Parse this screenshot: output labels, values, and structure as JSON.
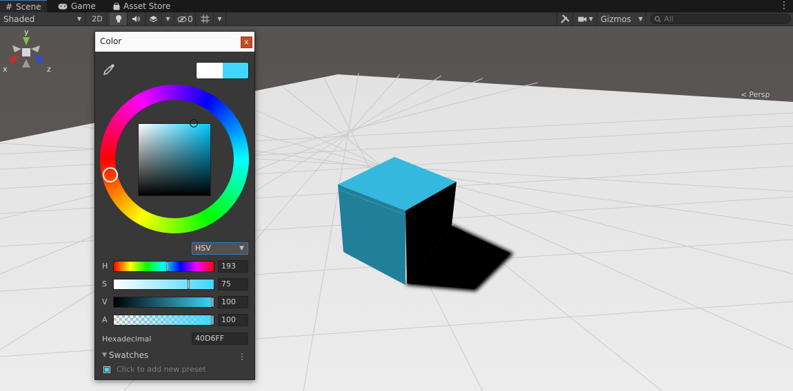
{
  "tabs": [
    {
      "label": "Scene",
      "icon": "grid-icon",
      "active": true
    },
    {
      "label": "Game",
      "icon": "gamepad-icon",
      "active": false
    },
    {
      "label": "Asset Store",
      "icon": "bag-icon",
      "active": false
    }
  ],
  "toolbar": {
    "shading_mode": "Shaded",
    "mode_2d": "2D",
    "hidden_count": "0",
    "gizmos_label": "Gizmos",
    "search_placeholder": "All"
  },
  "scene": {
    "orientation": {
      "x": "x",
      "y": "y",
      "z": "z"
    },
    "projection": "Persp",
    "cube_color": "#3ab3d8"
  },
  "color_window": {
    "title": "Color",
    "close_label": "x",
    "previous_color": "#ffffff",
    "current_color": "#40d6ff",
    "mode": "HSV",
    "sliders": [
      {
        "label": "H",
        "value": "193"
      },
      {
        "label": "S",
        "value": "75"
      },
      {
        "label": "V",
        "value": "100"
      },
      {
        "label": "A",
        "value": "100"
      }
    ],
    "hex_label": "Hexadecimal",
    "hex_value": "40D6FF",
    "swatches_label": "Swatches",
    "swatches_menu": "⋮",
    "swatches_hint": "Click to add new preset"
  }
}
